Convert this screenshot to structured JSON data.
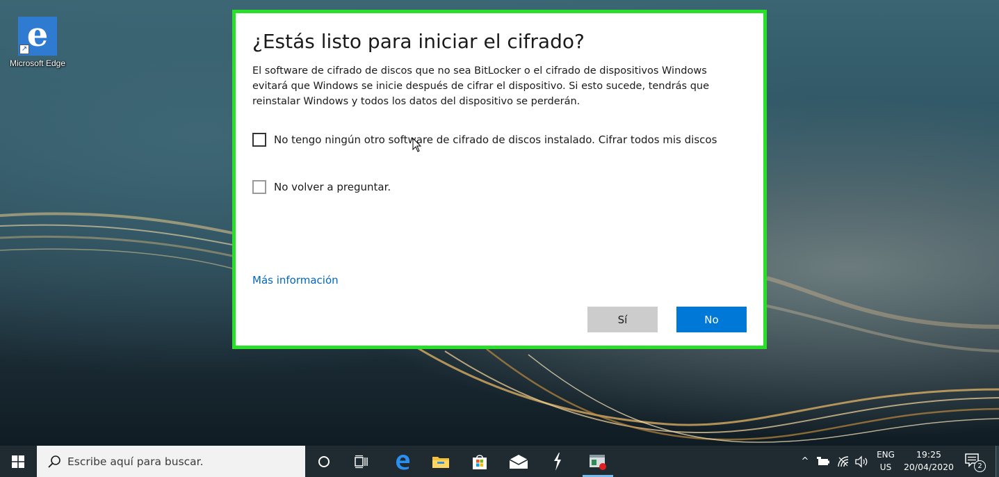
{
  "desktop": {
    "shortcut_label": "Microsoft Edge"
  },
  "dialog": {
    "title": "¿Estás listo para iniciar el cifrado?",
    "description": "El software de cifrado de discos que no sea BitLocker o el cifrado de dispositivos Windows evitará que Windows se inicie después de cifrar el dispositivo. Si esto sucede, tendrás que reinstalar Windows y todos los datos del dispositivo se perderán.",
    "checkbox_no_other_software": {
      "label": "No tengo ningún otro software de cifrado de discos instalado. Cifrar todos mis discos",
      "checked": false
    },
    "checkbox_dont_ask": {
      "label": "No volver a preguntar.",
      "checked": false
    },
    "more_info_link": "Más información",
    "yes_button": "Sí",
    "no_button": "No"
  },
  "taskbar": {
    "search_placeholder": "Escribe aquí para buscar.",
    "pinned": [
      "cortana-icon",
      "task-view-icon",
      "edge-icon",
      "file-explorer-icon",
      "store-icon",
      "mail-icon",
      "app-icon",
      "active-app-icon"
    ],
    "tray": {
      "lang_top": "ENG",
      "lang_bottom": "US",
      "time": "19:25",
      "date": "20/04/2020",
      "notification_count": "2"
    }
  },
  "colors": {
    "accent": "#0078d7",
    "link": "#0067c0",
    "highlight_border": "#28e028",
    "secondary_button": "#cccccc",
    "taskbar": "#1f2b31"
  }
}
